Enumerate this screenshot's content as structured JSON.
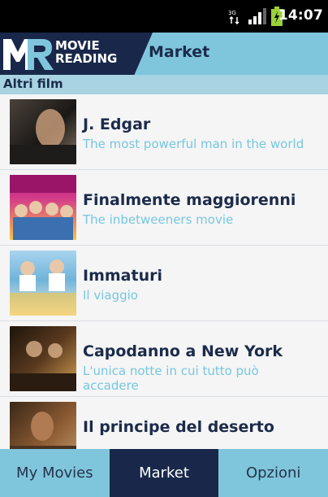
{
  "status_bar": {
    "time": "14:07",
    "icons": [
      "data-sync-icon",
      "signal-bars-icon",
      "battery-charging-icon"
    ]
  },
  "header": {
    "logo_line1": "MOVIE",
    "logo_line2": "READING",
    "title": "Market"
  },
  "section": {
    "title": "Altri film"
  },
  "movies": [
    {
      "title": "J. Edgar",
      "subtitle": "The most powerful man in the world",
      "thumb_colors": [
        "#2b2a28",
        "#8b7a6a"
      ]
    },
    {
      "title": "Finalmente maggiorenni",
      "subtitle": "The inbetweeners movie",
      "thumb_colors": [
        "#b11d7a",
        "#f4c542"
      ]
    },
    {
      "title": "Immaturi",
      "subtitle": "Il viaggio",
      "thumb_colors": [
        "#6fb4da",
        "#f0a020"
      ]
    },
    {
      "title": "Capodanno a New York",
      "subtitle": "L'unica notte in cui tutto può accadere",
      "thumb_colors": [
        "#3a2a1a",
        "#d6a254"
      ]
    },
    {
      "title": "Il principe del deserto",
      "subtitle": "",
      "thumb_colors": [
        "#6b4a2a",
        "#c49a6a"
      ]
    }
  ],
  "tabs": [
    {
      "label": "My Movies",
      "active": false
    },
    {
      "label": "Market",
      "active": true
    },
    {
      "label": "Opzioni",
      "active": false
    }
  ],
  "colors": {
    "header_bg": "#7fc6dc",
    "logo_bg": "#19284a",
    "section_bg": "#a7d3e2",
    "title_text": "#1c2b4b",
    "subtitle_text": "#76c7e0"
  }
}
